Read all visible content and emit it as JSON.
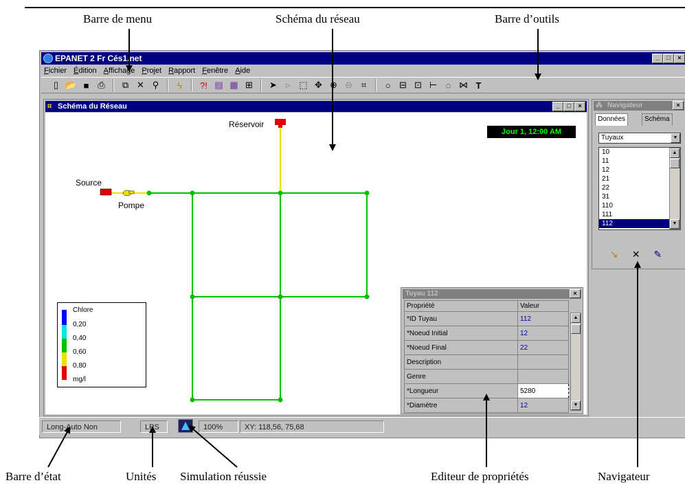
{
  "callouts": {
    "menu_bar": "Barre de menu",
    "network_map": "Schéma du réseau",
    "toolbar": "Barre d’outils",
    "status_bar": "Barre d’état",
    "units": "Unités",
    "run_ok": "Simulation réussie",
    "property_editor": "Editeur de propriétés",
    "navigator": "Navigateur"
  },
  "app": {
    "title": "EPANET 2 Fr  Cés1.net",
    "menu": [
      "Fichier",
      "Édition",
      "Affichage",
      "Projet",
      "Rapport",
      "Fenêtre",
      "Aide"
    ],
    "toolbar_icons": [
      "new-icon",
      "open-icon",
      "save-icon",
      "print-icon",
      "copy-icon",
      "delete-icon",
      "find-icon",
      "run-icon",
      "query-icon",
      "graph-icon",
      "table-icon",
      "options-icon",
      "select-icon",
      "vertex-icon",
      "region-icon",
      "pan-icon",
      "zoom-in-icon",
      "zoom-out-icon",
      "full-extent-icon",
      "junction-icon",
      "reservoir-icon",
      "tank-icon",
      "pipe-icon",
      "pump-icon",
      "valve-icon",
      "label-icon"
    ]
  },
  "map": {
    "title": "Schéma du Réseau",
    "clock": "Jour 1, 12:00 AM",
    "labels": {
      "reservoir": "Réservoir",
      "source": "Source",
      "pump": "Pompe"
    }
  },
  "legend": {
    "title": "Chlore",
    "ticks": [
      "0,20",
      "0,40",
      "0,60",
      "0,80"
    ],
    "unit": "mg/l",
    "colors": [
      "#0000ff",
      "#00e5e5",
      "#00c000",
      "#f0e000",
      "#e00000"
    ]
  },
  "property_editor": {
    "title": "Tuyau 112",
    "headers": {
      "property": "Propriété",
      "value": "Valeur"
    },
    "rows": [
      {
        "property": "*ID Tuyau",
        "value": "112"
      },
      {
        "property": "*Noeud Initial",
        "value": "12"
      },
      {
        "property": "*Noeud Final",
        "value": "22"
      },
      {
        "property": "Description",
        "value": ""
      },
      {
        "property": "Genre",
        "value": ""
      },
      {
        "property": "*Longueur",
        "value": "5280"
      },
      {
        "property": "*Diamètre",
        "value": "12"
      }
    ]
  },
  "navigator": {
    "title": "Navigateur",
    "tabs": [
      "Données",
      "Schéma"
    ],
    "category": "Tuyaux",
    "items": [
      "10",
      "11",
      "12",
      "21",
      "22",
      "31",
      "110",
      "111",
      "112"
    ],
    "selected": "112"
  },
  "status_bar": {
    "auto_length": "Long-Auto Non",
    "units": "LPS",
    "zoom": "100%",
    "xy": "XY: 118,56, 75,68"
  }
}
